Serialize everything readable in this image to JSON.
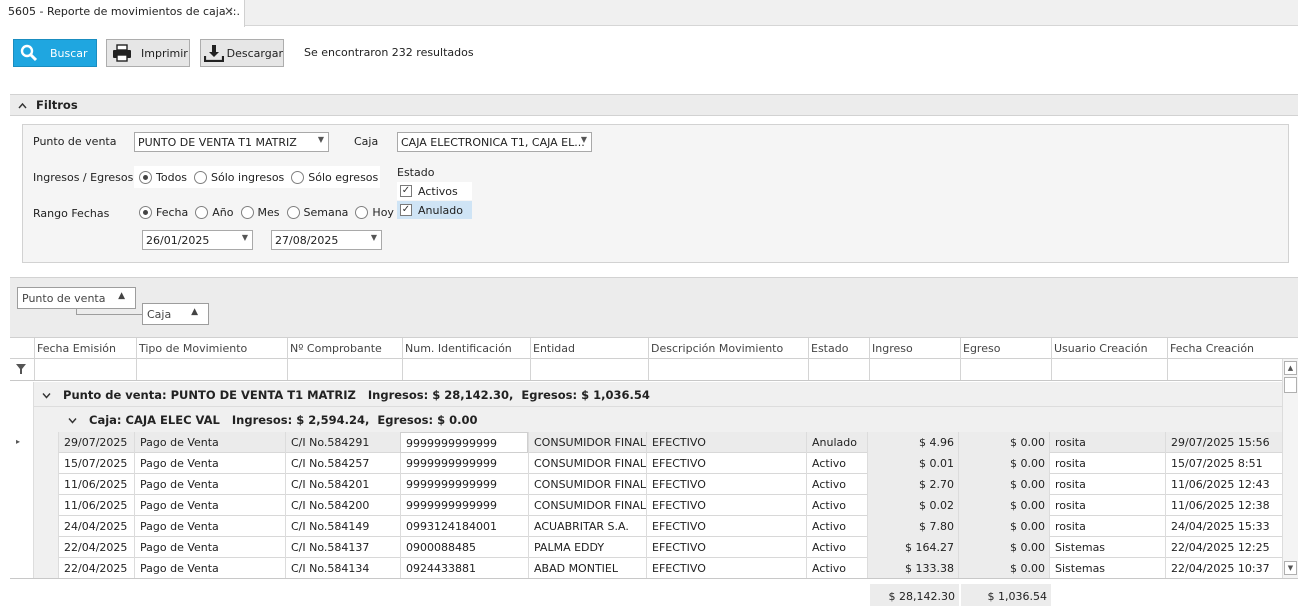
{
  "tab": {
    "title": "5605 - Reporte de movimientos de caja ::.",
    "close": "×"
  },
  "toolbar": {
    "search_label": "Buscar",
    "print_label": "Imprimir",
    "download_label": "Descargar",
    "results_text": "Se encontraron 232 resultados"
  },
  "filters": {
    "header": "Filtros",
    "punto_venta_label": "Punto de venta",
    "punto_venta_value": "PUNTO DE VENTA T1 MATRIZ",
    "caja_label": "Caja",
    "caja_value": "CAJA ELECTRONICA T1, CAJA EL...",
    "ing_egr_label": "Ingresos / Egresos",
    "ing_egr_options": [
      "Todos",
      "Sólo ingresos",
      "Sólo egresos"
    ],
    "ing_egr_selected": "Todos",
    "rango_label": "Rango Fechas",
    "rango_options": [
      "Fecha",
      "Año",
      "Mes",
      "Semana",
      "Hoy"
    ],
    "rango_selected": "Fecha",
    "date_from": "26/01/2025",
    "date_to": "27/08/2025",
    "estado_label": "Estado",
    "estado_options": [
      {
        "label": "Activos",
        "checked": true
      },
      {
        "label": "Anulado",
        "checked": true
      }
    ]
  },
  "grouping": {
    "chip1": "Punto de venta",
    "chip2": "Caja"
  },
  "columns": [
    "Fecha Emisión",
    "Tipo de Movimiento",
    "Nº Comprobante",
    "Num. Identificación",
    "Entidad",
    "Descripción Movimiento",
    "Estado",
    "Ingreso",
    "Egreso",
    "Usuario Creación",
    "Fecha Creación"
  ],
  "group1": "Punto de venta: PUNTO DE VENTA T1 MATRIZ   Ingresos: $ 28,142.30,  Egresos: $ 1,036.54",
  "group2": "Caja: CAJA ELEC VAL   Ingresos: $ 2,594.24,  Egresos: $ 0.00",
  "rows": [
    [
      "29/07/2025",
      "Pago de Venta",
      "C/I No.584291",
      "9999999999999",
      "CONSUMIDOR FINAL",
      "EFECTIVO",
      "Anulado",
      "$ 4.96",
      "$ 0.00",
      "rosita",
      "29/07/2025 15:56"
    ],
    [
      "15/07/2025",
      "Pago de Venta",
      "C/I No.584257",
      "9999999999999",
      "CONSUMIDOR FINAL",
      "EFECTIVO",
      "Activo",
      "$ 0.01",
      "$ 0.00",
      "rosita",
      "15/07/2025 8:51"
    ],
    [
      "11/06/2025",
      "Pago de Venta",
      "C/I No.584201",
      "9999999999999",
      "CONSUMIDOR FINAL",
      "EFECTIVO",
      "Activo",
      "$ 2.70",
      "$ 0.00",
      "rosita",
      "11/06/2025 12:43"
    ],
    [
      "11/06/2025",
      "Pago de Venta",
      "C/I No.584200",
      "9999999999999",
      "CONSUMIDOR FINAL",
      "EFECTIVO",
      "Activo",
      "$ 0.02",
      "$ 0.00",
      "rosita",
      "11/06/2025 12:38"
    ],
    [
      "24/04/2025",
      "Pago de Venta",
      "C/I No.584149",
      "0993124184001",
      "ACUABRITAR S.A.",
      "EFECTIVO",
      "Activo",
      "$ 7.80",
      "$ 0.00",
      "rosita",
      "24/04/2025 15:33"
    ],
    [
      "22/04/2025",
      "Pago de Venta",
      "C/I No.584137",
      "0900088485",
      "PALMA EDDY",
      "EFECTIVO",
      "Activo",
      "$ 164.27",
      "$ 0.00",
      "Sistemas",
      "22/04/2025 12:25"
    ],
    [
      "22/04/2025",
      "Pago de Venta",
      "C/I No.584134",
      "0924433881",
      "ABAD MONTIEL",
      "EFECTIVO",
      "Activo",
      "$ 133.38",
      "$ 0.00",
      "Sistemas",
      "22/04/2025 10:37"
    ]
  ],
  "totals": {
    "ingreso": "$ 28,142.30",
    "egreso": "$ 1,036.54"
  },
  "colors": {
    "accent": "#1fa6e0",
    "selected_row": "#ebebeb",
    "panel": "#f5f5f5"
  }
}
